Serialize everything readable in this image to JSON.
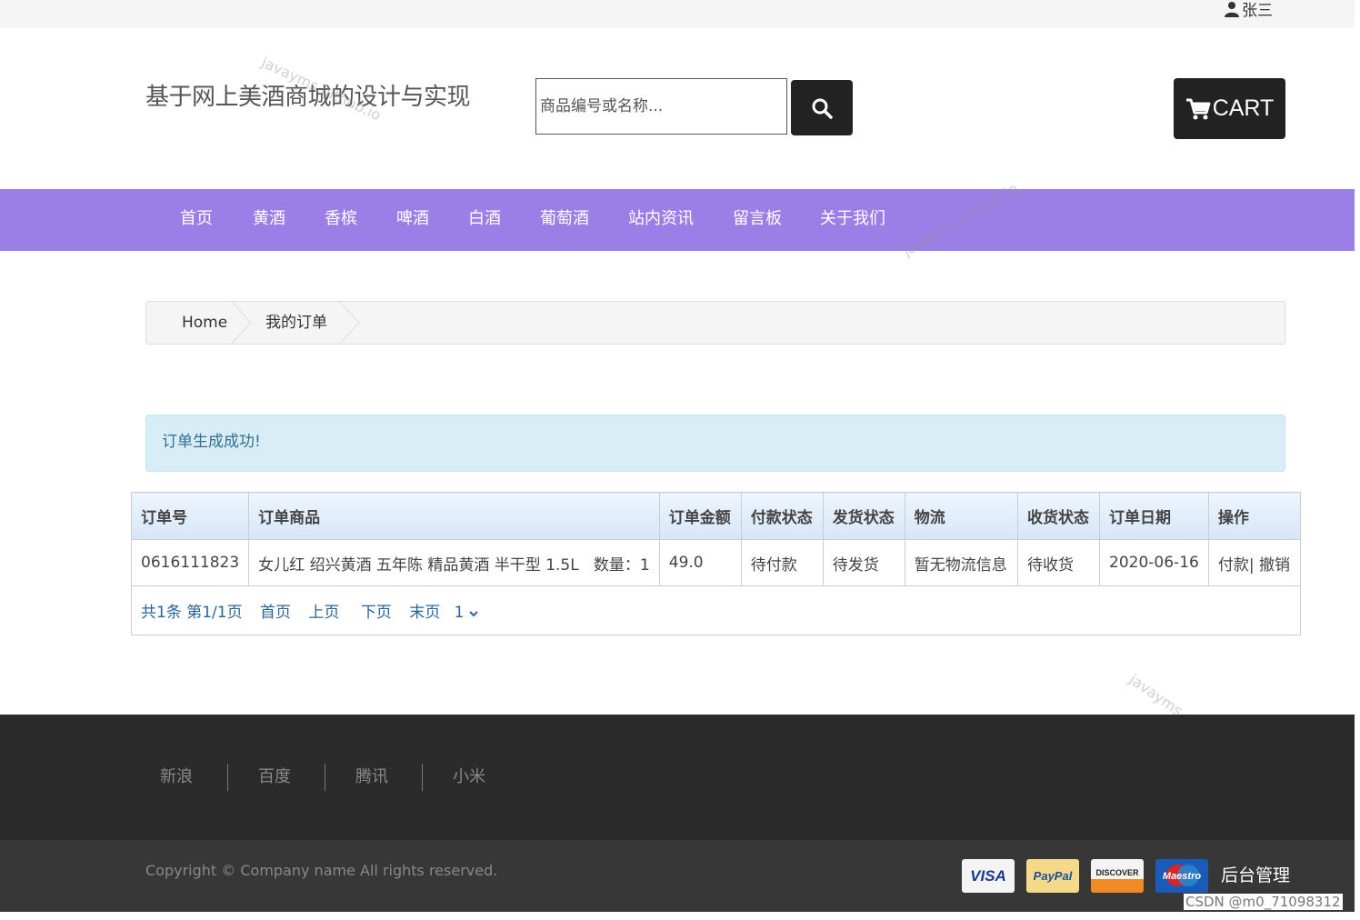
{
  "topbar": {
    "username": "张三"
  },
  "header": {
    "title": "基于网上美酒商城的设计与实现",
    "search_placeholder": "商品编号或名称...",
    "cart_label": "CART"
  },
  "nav": {
    "items": [
      {
        "label": "首页"
      },
      {
        "label": "黄酒"
      },
      {
        "label": "香槟"
      },
      {
        "label": "啤酒"
      },
      {
        "label": "白酒"
      },
      {
        "label": "葡萄酒"
      },
      {
        "label": "站内资讯"
      },
      {
        "label": "留言板"
      },
      {
        "label": "关于我们"
      }
    ]
  },
  "breadcrumb": {
    "home": "Home",
    "current": "我的订单"
  },
  "alert": {
    "message": "订单生成成功!"
  },
  "orders": {
    "headers": [
      "订单号",
      "订单商品",
      "订单金额",
      "付款状态",
      "发货状态",
      "物流",
      "收货状态",
      "订单日期",
      "操作"
    ],
    "rows": [
      {
        "order_no": "0616111823",
        "product": "女儿红 绍兴黄酒 五年陈 精品黄酒 半干型 1.5L",
        "quantity_label": "数量：1",
        "amount": "49.0",
        "pay_status": "待付款",
        "ship_status": "待发货",
        "logistics": "暂无物流信息",
        "receive_status": "待收货",
        "date": "2020-06-16",
        "op_pay": "付款",
        "op_sep": "|",
        "op_cancel": "撤销"
      }
    ],
    "pager": {
      "total": "共1条",
      "page_info": "第1/1页",
      "first": "首页",
      "prev": "上页",
      "next": "下页",
      "last": "末页",
      "selected_page": "1"
    }
  },
  "footer": {
    "links": [
      {
        "label": "新浪"
      },
      {
        "label": "百度"
      },
      {
        "label": "腾讯"
      },
      {
        "label": "小米"
      }
    ],
    "copyright": "Copyright © Company name All rights reserved.",
    "payment_cards": [
      {
        "label": "VISA",
        "icon": "visa-card-icon"
      },
      {
        "label": "PayPal",
        "icon": "paypal-card-icon"
      },
      {
        "label": "DISCOVER",
        "icon": "discover-card-icon"
      },
      {
        "label": "Maestro",
        "icon": "maestro-card-icon"
      }
    ],
    "admin_label": "后台管理"
  },
  "watermarks": {
    "text": "javayms.github.io",
    "short": "javayms"
  },
  "csdn_watermark": "CSDN @m0_71098312",
  "colors": {
    "nav_bg": "#9b7fe6",
    "alert_bg": "#d9edf7",
    "alert_text": "#31708f",
    "footer_bg": "#2b2b2b",
    "button_dark": "#222222"
  }
}
